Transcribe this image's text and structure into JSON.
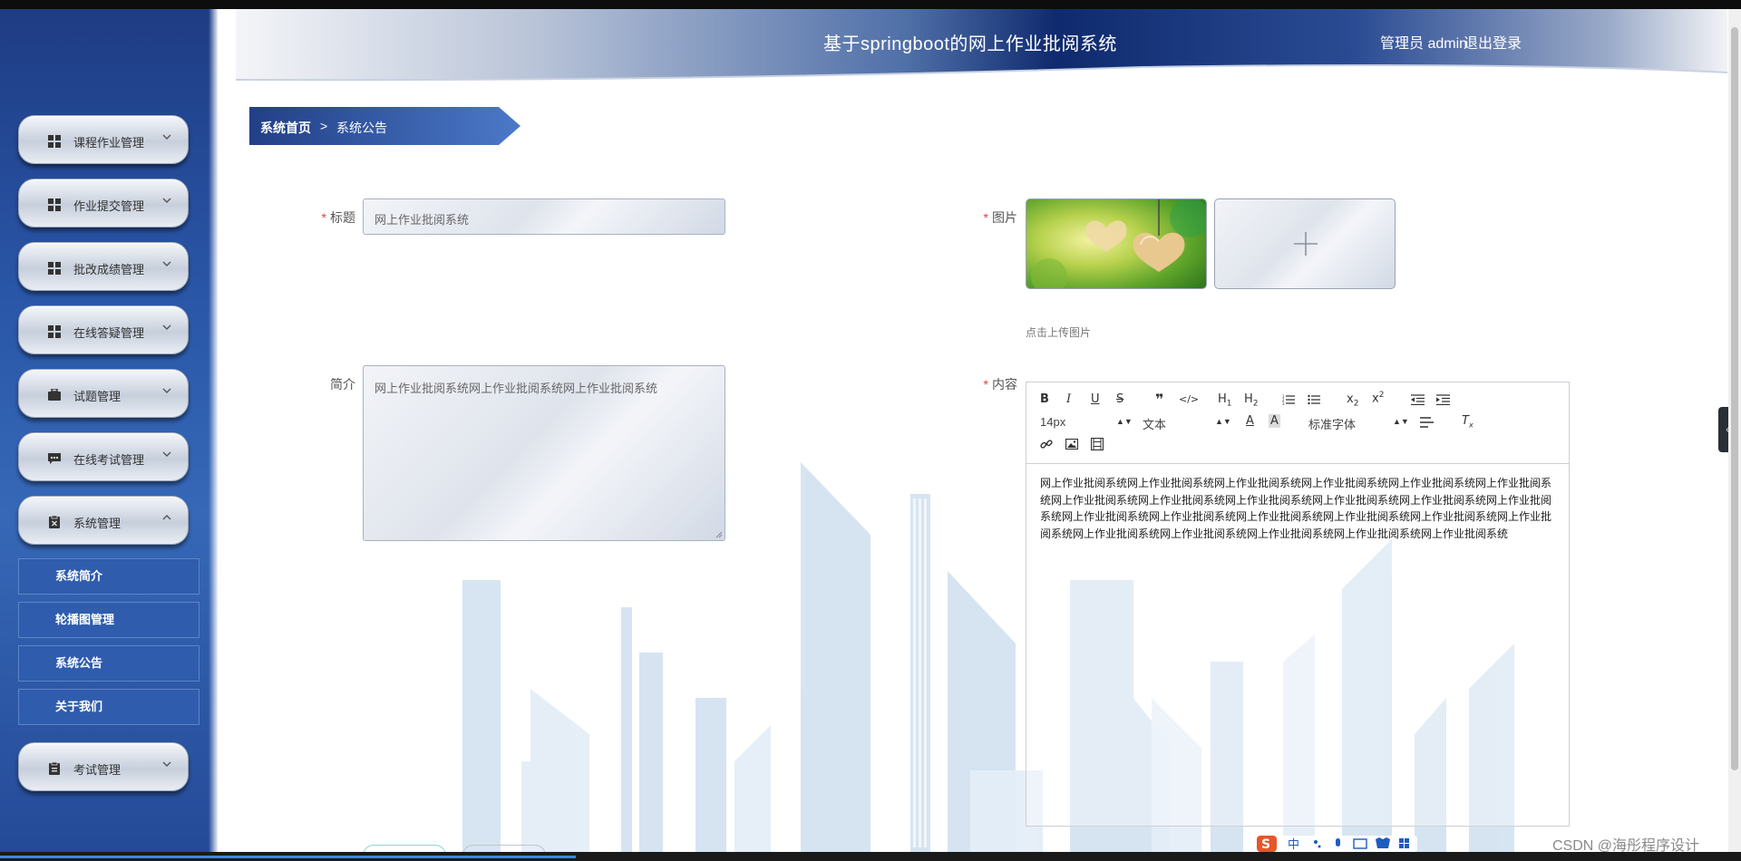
{
  "app": {
    "title": "基于springboot的网上作业批阅系统",
    "user_label": "管理员 admin",
    "logout_label": "退出登录"
  },
  "breadcrumb": {
    "home": "系统首页",
    "separator": ">",
    "current": "系统公告"
  },
  "sidebar": {
    "menus": [
      {
        "label": "课程作业管理",
        "icon": "grid-icon",
        "expanded": false
      },
      {
        "label": "作业提交管理",
        "icon": "grid-icon",
        "expanded": false
      },
      {
        "label": "批改成绩管理",
        "icon": "grid-icon",
        "expanded": false
      },
      {
        "label": "在线答疑管理",
        "icon": "grid-icon",
        "expanded": false
      },
      {
        "label": "试题管理",
        "icon": "briefcase-icon",
        "expanded": false
      },
      {
        "label": "在线考试管理",
        "icon": "chat-icon",
        "expanded": false
      },
      {
        "label": "系统管理",
        "icon": "clipboard-x-icon",
        "expanded": true
      },
      {
        "label": "考试管理",
        "icon": "clipboard-icon",
        "expanded": false
      }
    ],
    "submenu": [
      "系统简介",
      "轮播图管理",
      "系统公告",
      "关于我们"
    ]
  },
  "form": {
    "title_label": "标题",
    "title_value": "网上作业批阅系统",
    "summary_label": "简介",
    "summary_value": "网上作业批阅系统网上作业批阅系统网上作业批阅系统",
    "image_label": "图片",
    "upload_tip": "点击上传图片",
    "content_label": "内容"
  },
  "editor": {
    "font_size": "14px",
    "block_type": "文本",
    "font_family": "标准字体",
    "content": "网上作业批阅系统网上作业批阅系统网上作业批阅系统网上作业批阅系统网上作业批阅系统网上作业批阅系统网上作业批阅系统网上作业批阅系统网上作业批阅系统网上作业批阅系统网上作业批阅系统网上作业批阅系统网上作业批阅系统网上作业批阅系统网上作业批阅系统网上作业批阅系统网上作业批阅系统网上作业批阅系统网上作业批阅系统网上作业批阅系统网上作业批阅系统网上作业批阅系统网上作业批阅系统"
  },
  "watermark": "CSDN @海彤程序设计",
  "ime": {
    "label": "中"
  },
  "colors": {
    "sidebar": "#2a57a8",
    "header_dark": "#0f2a6e",
    "breadcrumb": "#2f5aa8",
    "required": "#e23c3c"
  }
}
